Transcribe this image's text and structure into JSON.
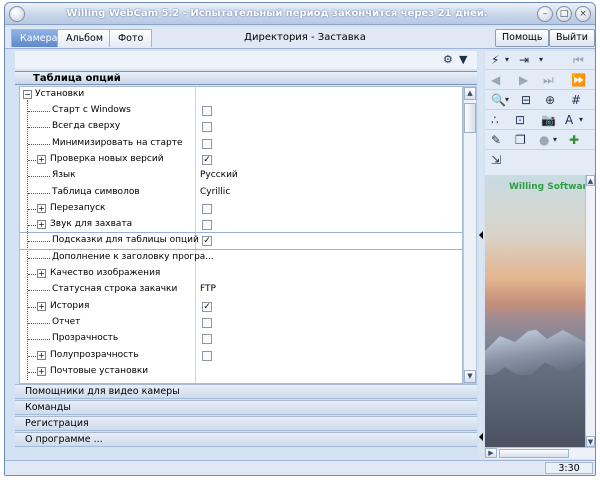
{
  "window": {
    "title": "Willing WebCam 5.2 - Испытательный период закончится через 21 дней."
  },
  "tabs": [
    {
      "label": "Камера",
      "active": true
    },
    {
      "label": "Альбом",
      "active": false
    },
    {
      "label": "Фото",
      "active": false
    }
  ],
  "header": {
    "section_title": "Директория - Заставка",
    "help_label": "Помощь",
    "exit_label": "Выйти"
  },
  "options": {
    "header": "Таблица опций",
    "root_label": "Установки",
    "rows": [
      {
        "label": "Старт с Windows",
        "type": "checkbox",
        "checked": false
      },
      {
        "label": "Всегда сверху",
        "type": "checkbox",
        "checked": false
      },
      {
        "label": "Минимизировать на старте",
        "type": "checkbox",
        "checked": false
      },
      {
        "label": "Проверка новых версий",
        "type": "checkbox",
        "checked": true,
        "expandable": true
      },
      {
        "label": "Язык",
        "type": "text",
        "value": "Русский"
      },
      {
        "label": "Таблица символов",
        "type": "text",
        "value": "Cyrillic"
      },
      {
        "label": "Перезапуск",
        "type": "checkbox",
        "checked": false,
        "expandable": true
      },
      {
        "label": "Звук для захвата",
        "type": "checkbox",
        "checked": false,
        "expandable": true
      },
      {
        "label": "Подсказки для таблицы опций",
        "type": "checkbox",
        "checked": true,
        "selected": true
      },
      {
        "label": "Дополнение к заголовку програ...",
        "type": "text",
        "value": ""
      },
      {
        "label": "Качество изображения",
        "type": "none",
        "expandable": true
      },
      {
        "label": "Статусная строка закачки",
        "type": "text",
        "value": "FTP"
      },
      {
        "label": "История",
        "type": "checkbox",
        "checked": true,
        "expandable": true
      },
      {
        "label": "Отчет",
        "type": "checkbox",
        "checked": false
      },
      {
        "label": "Прозрачность",
        "type": "checkbox",
        "checked": false
      },
      {
        "label": "Полупрозрачность",
        "type": "checkbox",
        "checked": false,
        "expandable": true
      },
      {
        "label": "Почтовые установки",
        "type": "none",
        "expandable": true
      }
    ]
  },
  "accordion": [
    "Помощники для видео камеры",
    "Команды",
    "Регистрация",
    "О программе ..."
  ],
  "preview": {
    "label": "Willing Software"
  },
  "status": {
    "time": "3:30"
  }
}
